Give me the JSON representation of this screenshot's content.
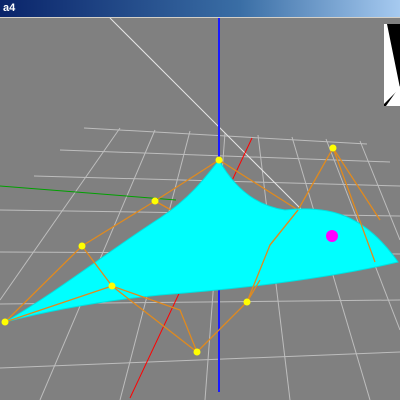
{
  "window": {
    "title": "a4",
    "background_color": "#808080",
    "titlebar_color": "#0a246a"
  },
  "scene": {
    "surface_color": "#00ffff",
    "control_point_color": "#ffff00",
    "control_polygon_color": "#e08a1e",
    "selected_point_color": "#ff00ff",
    "grid_color": "#c8c8c8",
    "axis_colors": {
      "x": "#ff0000",
      "y": "#00a000",
      "z": "#0000ff"
    },
    "light_ray_color": "#e6e6e6",
    "inset_background": "#ffffff",
    "inset_shape_color": "#000000"
  }
}
